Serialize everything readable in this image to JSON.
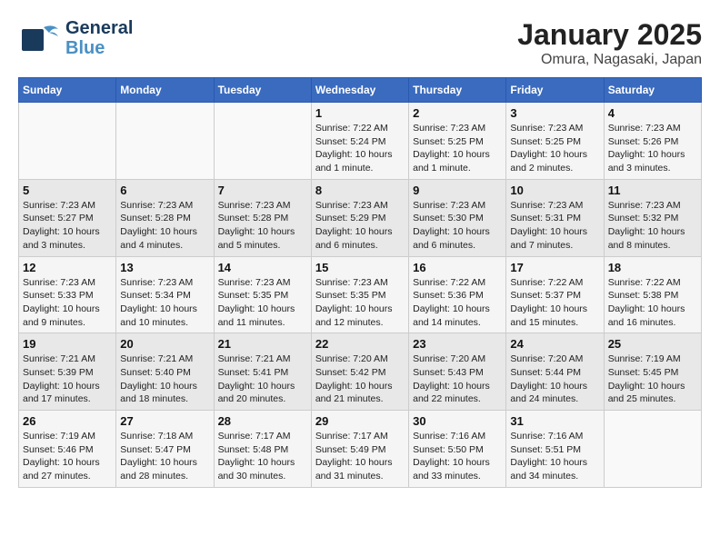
{
  "header": {
    "logo_line1": "General",
    "logo_line2": "Blue",
    "title": "January 2025",
    "subtitle": "Omura, Nagasaki, Japan"
  },
  "days_of_week": [
    "Sunday",
    "Monday",
    "Tuesday",
    "Wednesday",
    "Thursday",
    "Friday",
    "Saturday"
  ],
  "weeks": [
    [
      {
        "date": "",
        "info": ""
      },
      {
        "date": "",
        "info": ""
      },
      {
        "date": "",
        "info": ""
      },
      {
        "date": "1",
        "info": "Sunrise: 7:22 AM\nSunset: 5:24 PM\nDaylight: 10 hours\nand 1 minute."
      },
      {
        "date": "2",
        "info": "Sunrise: 7:23 AM\nSunset: 5:25 PM\nDaylight: 10 hours\nand 1 minute."
      },
      {
        "date": "3",
        "info": "Sunrise: 7:23 AM\nSunset: 5:25 PM\nDaylight: 10 hours\nand 2 minutes."
      },
      {
        "date": "4",
        "info": "Sunrise: 7:23 AM\nSunset: 5:26 PM\nDaylight: 10 hours\nand 3 minutes."
      }
    ],
    [
      {
        "date": "5",
        "info": "Sunrise: 7:23 AM\nSunset: 5:27 PM\nDaylight: 10 hours\nand 3 minutes."
      },
      {
        "date": "6",
        "info": "Sunrise: 7:23 AM\nSunset: 5:28 PM\nDaylight: 10 hours\nand 4 minutes."
      },
      {
        "date": "7",
        "info": "Sunrise: 7:23 AM\nSunset: 5:28 PM\nDaylight: 10 hours\nand 5 minutes."
      },
      {
        "date": "8",
        "info": "Sunrise: 7:23 AM\nSunset: 5:29 PM\nDaylight: 10 hours\nand 6 minutes."
      },
      {
        "date": "9",
        "info": "Sunrise: 7:23 AM\nSunset: 5:30 PM\nDaylight: 10 hours\nand 6 minutes."
      },
      {
        "date": "10",
        "info": "Sunrise: 7:23 AM\nSunset: 5:31 PM\nDaylight: 10 hours\nand 7 minutes."
      },
      {
        "date": "11",
        "info": "Sunrise: 7:23 AM\nSunset: 5:32 PM\nDaylight: 10 hours\nand 8 minutes."
      }
    ],
    [
      {
        "date": "12",
        "info": "Sunrise: 7:23 AM\nSunset: 5:33 PM\nDaylight: 10 hours\nand 9 minutes."
      },
      {
        "date": "13",
        "info": "Sunrise: 7:23 AM\nSunset: 5:34 PM\nDaylight: 10 hours\nand 10 minutes."
      },
      {
        "date": "14",
        "info": "Sunrise: 7:23 AM\nSunset: 5:35 PM\nDaylight: 10 hours\nand 11 minutes."
      },
      {
        "date": "15",
        "info": "Sunrise: 7:23 AM\nSunset: 5:35 PM\nDaylight: 10 hours\nand 12 minutes."
      },
      {
        "date": "16",
        "info": "Sunrise: 7:22 AM\nSunset: 5:36 PM\nDaylight: 10 hours\nand 14 minutes."
      },
      {
        "date": "17",
        "info": "Sunrise: 7:22 AM\nSunset: 5:37 PM\nDaylight: 10 hours\nand 15 minutes."
      },
      {
        "date": "18",
        "info": "Sunrise: 7:22 AM\nSunset: 5:38 PM\nDaylight: 10 hours\nand 16 minutes."
      }
    ],
    [
      {
        "date": "19",
        "info": "Sunrise: 7:21 AM\nSunset: 5:39 PM\nDaylight: 10 hours\nand 17 minutes."
      },
      {
        "date": "20",
        "info": "Sunrise: 7:21 AM\nSunset: 5:40 PM\nDaylight: 10 hours\nand 18 minutes."
      },
      {
        "date": "21",
        "info": "Sunrise: 7:21 AM\nSunset: 5:41 PM\nDaylight: 10 hours\nand 20 minutes."
      },
      {
        "date": "22",
        "info": "Sunrise: 7:20 AM\nSunset: 5:42 PM\nDaylight: 10 hours\nand 21 minutes."
      },
      {
        "date": "23",
        "info": "Sunrise: 7:20 AM\nSunset: 5:43 PM\nDaylight: 10 hours\nand 22 minutes."
      },
      {
        "date": "24",
        "info": "Sunrise: 7:20 AM\nSunset: 5:44 PM\nDaylight: 10 hours\nand 24 minutes."
      },
      {
        "date": "25",
        "info": "Sunrise: 7:19 AM\nSunset: 5:45 PM\nDaylight: 10 hours\nand 25 minutes."
      }
    ],
    [
      {
        "date": "26",
        "info": "Sunrise: 7:19 AM\nSunset: 5:46 PM\nDaylight: 10 hours\nand 27 minutes."
      },
      {
        "date": "27",
        "info": "Sunrise: 7:18 AM\nSunset: 5:47 PM\nDaylight: 10 hours\nand 28 minutes."
      },
      {
        "date": "28",
        "info": "Sunrise: 7:17 AM\nSunset: 5:48 PM\nDaylight: 10 hours\nand 30 minutes."
      },
      {
        "date": "29",
        "info": "Sunrise: 7:17 AM\nSunset: 5:49 PM\nDaylight: 10 hours\nand 31 minutes."
      },
      {
        "date": "30",
        "info": "Sunrise: 7:16 AM\nSunset: 5:50 PM\nDaylight: 10 hours\nand 33 minutes."
      },
      {
        "date": "31",
        "info": "Sunrise: 7:16 AM\nSunset: 5:51 PM\nDaylight: 10 hours\nand 34 minutes."
      },
      {
        "date": "",
        "info": ""
      }
    ]
  ]
}
